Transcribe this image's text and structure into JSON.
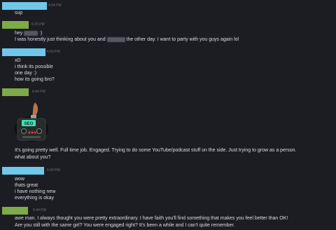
{
  "messages": [
    {
      "sender": "blue",
      "time": "4:04 PM",
      "lines": [
        "sup"
      ]
    },
    {
      "sender": "green",
      "time": "6:26 PM",
      "lines": [
        "hey",
        "I was honestly just thinking about you and",
        "the other day. I want to party with you guys again lol"
      ]
    },
    {
      "sender": "blue",
      "time": "6:43 PM",
      "lines": [
        "xD",
        "i think its possible",
        "one day :)",
        "how its going bro?"
      ]
    },
    {
      "sender": "green",
      "time": "6:44 PM",
      "lines": [
        "It's going pretty well. Full time job. Engaged. Trying to do some YouTube/podcast stuff on the side. Just trying to grow as a person.",
        "what about you?"
      ]
    },
    {
      "sender": "blue",
      "time": "6:40 PM",
      "lines": [
        "wow",
        "thats great",
        "i have nothing new",
        "everything is okay"
      ]
    },
    {
      "sender": "green",
      "time": "6:44 PM",
      "lines": [
        "awe man. I always thought you were pretty extraordinary. I have faith you'll find something that makes you feel better than OK!",
        "Are you still with the same girl? You were engaged right? It's been a while and I can't quite remember."
      ]
    }
  ],
  "extra_text": {
    "hey_suffix": ":)"
  },
  "sticker": {
    "label": "SEO"
  },
  "colors": {
    "blue": "#6fc8ea",
    "green": "#7dab49",
    "background": "#1c1d22"
  }
}
